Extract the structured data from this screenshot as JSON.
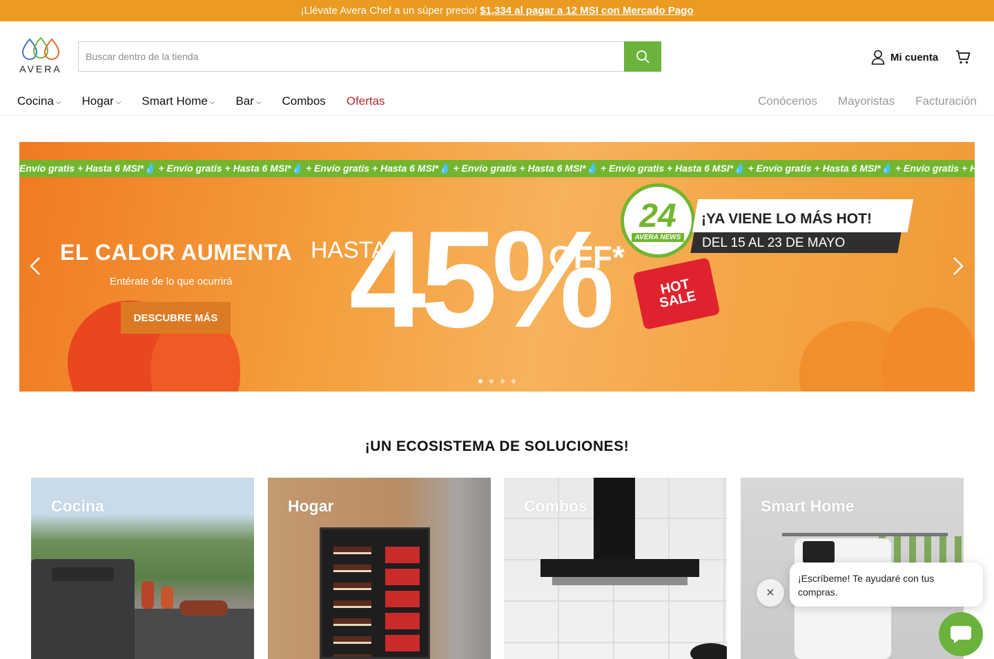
{
  "announcement": {
    "text": "¡Llévate Avera Chef a un súper precio!",
    "link": "$1,334 al pagar a 12 MSI con Mercado Pago"
  },
  "header": {
    "logo_text": "AVERA",
    "search_placeholder": "Buscar dentro de la tienda",
    "account_label": "Mi cuenta"
  },
  "nav": {
    "items": [
      {
        "label": "Cocina",
        "dropdown": true
      },
      {
        "label": "Hogar",
        "dropdown": true
      },
      {
        "label": "Smart Home",
        "dropdown": true
      },
      {
        "label": "Bar",
        "dropdown": true
      },
      {
        "label": "Combos",
        "dropdown": false
      },
      {
        "label": "Ofertas",
        "dropdown": false
      }
    ],
    "secondary": [
      "Conócenos",
      "Mayoristas",
      "Facturación"
    ]
  },
  "hero": {
    "ticker": "Envío gratis + Hasta 6 MSI*💧 + Envío gratis + Hasta 6 MSI*💧 + Envío gratis + Hasta 6 MSI*💧 + Envío gratis + Hasta 6 MSI*💧 + Envío gratis + Hasta 6 MSI*💧 + Envío gratis + Hasta 6 MSI*💧 + Envío gratis + Hasta 6",
    "heading": "EL CALOR AUMENTA",
    "subheading": "Entérate de lo que ocurrirá",
    "button": "DESCUBRE MÁS",
    "hasta": "HASTA",
    "percent": "45%",
    "off": "OFF*",
    "badge_number": "24",
    "badge_label": "AVERA NEWS",
    "banner_top": "¡YA VIENE LO MÁS HOT!",
    "banner_bottom": "DEL 15 AL 23 DE MAYO",
    "hotsale_1": "HOT",
    "hotsale_2": "SALE",
    "slides": 4,
    "active_slide": 1
  },
  "section": {
    "title": "¡UN ECOSISTEMA DE SOLUCIONES!",
    "cards": [
      "Cocina",
      "Hogar",
      "Combos",
      "Smart Home"
    ]
  },
  "chat": {
    "message": "¡Escríbeme! Te ayudaré con tus compras."
  },
  "colors": {
    "accent_green": "#6bb33c",
    "announcement_orange": "#eb9b21",
    "sale_red": "#c0262d"
  }
}
